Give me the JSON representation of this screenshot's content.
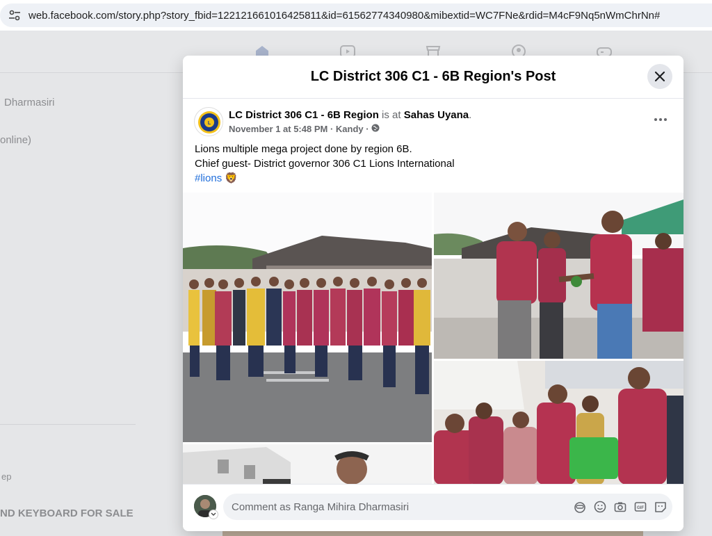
{
  "browser": {
    "url": "web.facebook.com/story.php?story_fbid=122121661016425811&id=61562774340980&mibextid=WC7FNe&rdid=M4cF9Nq5nWmChrNn#"
  },
  "background": {
    "items": [
      "Dharmasiri",
      "online)",
      "ep",
      "ND KEYBOARD FOR SALE"
    ]
  },
  "modal": {
    "title": "LC District 306 C1 - 6B Region's Post",
    "post": {
      "page_name": "LC District 306 C1 - 6B Region",
      "connector": " is at ",
      "place": "Sahas Uyana",
      "place_suffix": ".",
      "timestamp": "November 1 at 5:48 PM",
      "location": " · Kandy · ",
      "body_line1": "Lions multiple mega project done by region 6B.",
      "body_line2": "Chief guest- District governor 306 C1 Lions International",
      "hashtag": "#lions",
      "emoji": "🦁"
    },
    "comment": {
      "placeholder": "Comment as Ranga Mihira Dharmasiri"
    }
  },
  "icons": {
    "accent": "#216fdb"
  }
}
